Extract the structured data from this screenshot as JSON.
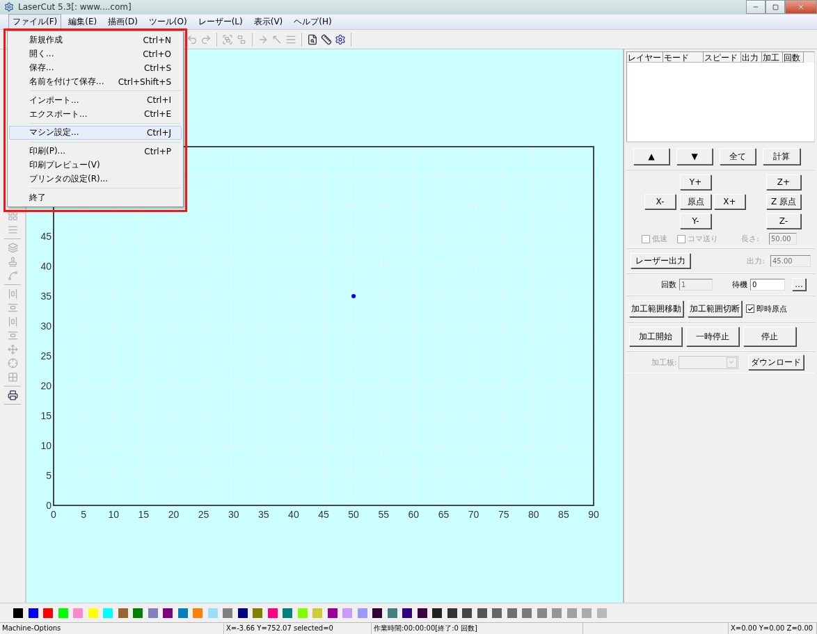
{
  "window": {
    "title": "LaserCut 5.3[: www....com]"
  },
  "menu_bar": [
    {
      "label": "ファイル(F)",
      "selected": true
    },
    {
      "label": "編集(E)",
      "selected": false
    },
    {
      "label": "描画(D)",
      "selected": false
    },
    {
      "label": "ツール(O)",
      "selected": false
    },
    {
      "label": "レーザー(L)",
      "selected": false
    },
    {
      "label": "表示(V)",
      "selected": false
    },
    {
      "label": "ヘルプ(H)",
      "selected": false
    }
  ],
  "file_menu": [
    {
      "kind": "item",
      "label": "新規作成",
      "shortcut": "Ctrl+N",
      "selected": false
    },
    {
      "kind": "item",
      "label": "開く...",
      "shortcut": "Ctrl+O",
      "selected": false
    },
    {
      "kind": "item",
      "label": "保存...",
      "shortcut": "Ctrl+S",
      "selected": false
    },
    {
      "kind": "item",
      "label": "名前を付けて保存...",
      "shortcut": "Ctrl+Shift+S",
      "selected": false
    },
    {
      "kind": "separator"
    },
    {
      "kind": "item",
      "label": "インポート...",
      "shortcut": "Ctrl+I",
      "selected": false
    },
    {
      "kind": "item",
      "label": "エクスポート...",
      "shortcut": "Ctrl+E",
      "selected": false
    },
    {
      "kind": "separator"
    },
    {
      "kind": "item",
      "label": "マシン設定...",
      "shortcut": "Ctrl+J",
      "selected": true
    },
    {
      "kind": "separator"
    },
    {
      "kind": "item",
      "label": "印刷(P)...",
      "shortcut": "Ctrl+P",
      "selected": false
    },
    {
      "kind": "item",
      "label": "印刷プレビュー(V)",
      "selected": false
    },
    {
      "kind": "item",
      "label": "プリンタの設定(R)...",
      "selected": false
    },
    {
      "kind": "separator"
    },
    {
      "kind": "item",
      "label": "終了",
      "selected": false
    }
  ],
  "annotation": {
    "kind": "rectangle"
  },
  "canvas": {
    "chart_data": {
      "type": "scatter",
      "grid": true,
      "x": [
        50
      ],
      "values": [
        35
      ],
      "xlim": [
        0,
        90
      ],
      "ylim": [
        0,
        60
      ],
      "xticks": [
        0,
        5,
        10,
        15,
        20,
        25,
        30,
        35,
        40,
        45,
        50,
        55,
        60,
        65,
        70,
        75,
        80,
        85,
        90
      ],
      "yticks": [
        0,
        5,
        10,
        15,
        20,
        25,
        30,
        35,
        40,
        45
      ]
    }
  },
  "layer_list": {
    "columns": [
      "レイヤー",
      "モード",
      "スピード",
      "出力",
      "加工",
      "回数"
    ]
  },
  "order_buttons": [
    "▲",
    "▼",
    "全て",
    "計算"
  ],
  "jog": {
    "y_plus": "Y+",
    "x_minus": "X-",
    "origin": "原点",
    "x_plus": "X+",
    "y_minus": "Y-",
    "z_plus": "Z+",
    "z_origin": "Z 原点",
    "z_minus": "Z-"
  },
  "jog_options": [
    {
      "label": "低速",
      "checked": false,
      "disabled": true
    },
    {
      "label": "コマ送り",
      "checked": false,
      "disabled": true
    }
  ],
  "length": {
    "label": "長さ:",
    "value": "50.00",
    "disabled": true
  },
  "laser_button": "レーザー出力",
  "power": {
    "label": "出力:",
    "value": "45.00",
    "disabled": true
  },
  "repeat": {
    "label": "回数",
    "value": "1",
    "disabled": true
  },
  "wait": {
    "label": "待機",
    "value": "0",
    "disabled": false
  },
  "more_button": "...",
  "range_buttons": [
    "加工範囲移動",
    "加工範囲切断"
  ],
  "instant_origin": {
    "label": "即時原点",
    "checked": true,
    "disabled": false
  },
  "run_buttons": [
    "加工開始",
    "一時停止",
    "停止"
  ],
  "job": {
    "label": "加工板:",
    "disabled": true
  },
  "download_button": "ダウンロード",
  "palette": [
    {
      "color": "#000000"
    },
    {
      "color": "#0000ff"
    },
    {
      "color": "#ff0000"
    },
    {
      "color": "#00ff00"
    },
    {
      "color": "#ff88cc"
    },
    {
      "color": "#ffff00"
    },
    {
      "color": "#00ffff"
    },
    {
      "color": "#996633"
    },
    {
      "color": "#008000"
    },
    {
      "color": "#8080c0"
    },
    {
      "color": "#800080"
    },
    {
      "color": "#0080c0"
    },
    {
      "color": "#ff8000"
    },
    {
      "color": "#99ddff"
    },
    {
      "color": "#808080"
    },
    {
      "color": "#000080"
    },
    {
      "color": "#808000"
    },
    {
      "color": "#ff0080"
    },
    {
      "color": "#008080"
    },
    {
      "color": "#80ff00"
    },
    {
      "color": "#cccc33"
    },
    {
      "color": "#990099"
    },
    {
      "color": "#cc99ff"
    },
    {
      "color": "#9999ff"
    },
    {
      "color": "#330033"
    },
    {
      "color": "#408080"
    },
    {
      "color": "#330080"
    },
    {
      "color": "#400040"
    },
    {
      "color": "#222222"
    },
    {
      "color": "#333333"
    },
    {
      "color": "#444444"
    },
    {
      "color": "#555555"
    },
    {
      "color": "#666666"
    },
    {
      "color": "#707070"
    },
    {
      "color": "#7a7a7a"
    },
    {
      "color": "#888888"
    },
    {
      "color": "#959595"
    },
    {
      "color": "#a0a0a0"
    },
    {
      "color": "#aaaaaa"
    },
    {
      "color": "#b8b8b8"
    }
  ],
  "status_bar": [
    "Machine-Options",
    "X=-3.66 Y=752.07 selected=0",
    "作業時間:00:00:00[終了:0 回数]",
    "X=0.00 Y=0.00 Z=0.00"
  ]
}
